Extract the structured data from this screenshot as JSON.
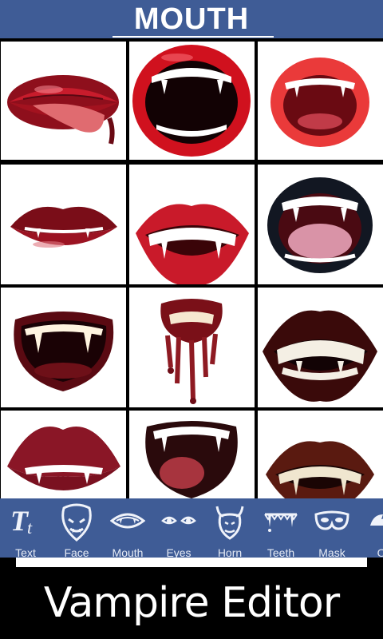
{
  "header": {
    "title": "MOUTH"
  },
  "mouths": [
    {
      "id": "m1",
      "style": "closed-lips-tongue"
    },
    {
      "id": "m2",
      "style": "open-fangs"
    },
    {
      "id": "m3",
      "style": "open-small-fangs"
    },
    {
      "id": "m4",
      "style": "closed-lips-fangs"
    },
    {
      "id": "m5",
      "style": "grin-fangs"
    },
    {
      "id": "m6",
      "style": "dark-lips-tongue"
    },
    {
      "id": "m7",
      "style": "open-dark-fangs"
    },
    {
      "id": "m8",
      "style": "dripping-blood"
    },
    {
      "id": "m9",
      "style": "wide-grin"
    },
    {
      "id": "m10",
      "style": "closed-lips-fangs"
    },
    {
      "id": "m11",
      "style": "open-tongue-fangs"
    },
    {
      "id": "m12",
      "style": "grin-fangs-brown"
    }
  ],
  "toolbar": {
    "items": [
      {
        "label": "Text",
        "icon": "text-icon"
      },
      {
        "label": "Face",
        "icon": "vampire-face-icon"
      },
      {
        "label": "Mouth",
        "icon": "mouth-icon"
      },
      {
        "label": "Eyes",
        "icon": "eyes-icon"
      },
      {
        "label": "Horn",
        "icon": "horn-icon"
      },
      {
        "label": "Teeth",
        "icon": "teeth-icon"
      },
      {
        "label": "Mask",
        "icon": "mask-icon"
      },
      {
        "label": "Ot",
        "icon": "other-icon"
      }
    ]
  },
  "footer": {
    "title": "Vampire Editor"
  },
  "colors": {
    "primary": "#3f5c96",
    "lip": "#c0182a",
    "dark_lip": "#6a0f1a"
  }
}
